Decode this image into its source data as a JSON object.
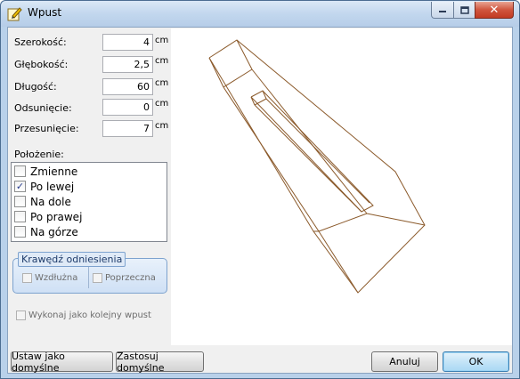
{
  "window": {
    "title": "Wpust",
    "icon": "edit-icon",
    "close_glyph": "✕"
  },
  "fields": [
    {
      "label": "Szerokość:",
      "value": "4",
      "unit": "cm"
    },
    {
      "label": "Głębokość:",
      "value": "2,5",
      "unit": "cm"
    },
    {
      "label": "Długość:",
      "value": "60",
      "unit": "cm"
    },
    {
      "label": "Odsunięcie:",
      "value": "0",
      "unit": "cm"
    },
    {
      "label": "Przesunięcie:",
      "value": "7",
      "unit": "cm"
    }
  ],
  "polozenie": {
    "label": "Położenie:",
    "options": [
      {
        "label": "Zmienne",
        "checked": false
      },
      {
        "label": "Po lewej",
        "checked": true
      },
      {
        "label": "Na dole",
        "checked": false
      },
      {
        "label": "Po prawej",
        "checked": false
      },
      {
        "label": "Na górze",
        "checked": false
      }
    ],
    "check_glyph": "✓"
  },
  "krawedz": {
    "title": "Krawędź odniesienia",
    "wzdluzna": "Wzdłużna",
    "poprzeczna": "Poprzeczna"
  },
  "kolejny": "Wykonaj jako kolejny wpust",
  "buttons": {
    "set_default": "Ustaw jako domyślne",
    "apply_default": "Zastosuj domyślne",
    "cancel": "Anuluj",
    "ok": "OK"
  },
  "colors": {
    "preview_line": "#8b5a2b",
    "title_bar": "#c2d7ee"
  }
}
